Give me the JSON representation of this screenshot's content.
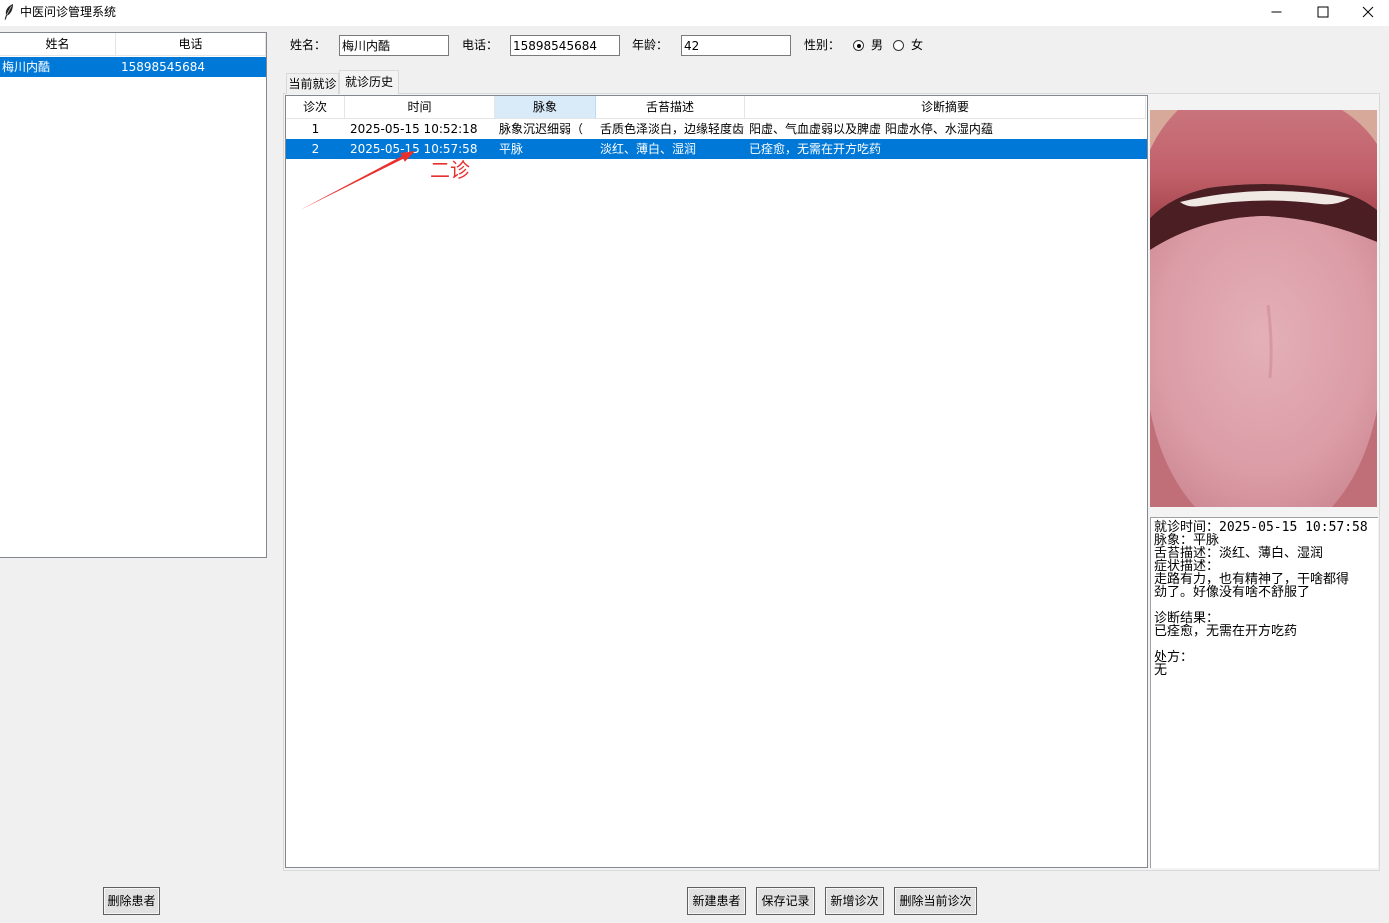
{
  "window": {
    "title": "中医问诊管理系统"
  },
  "icons": {
    "app": "feather-icon",
    "minimize": "minimize-icon",
    "maximize": "maximize-icon",
    "close": "close-icon",
    "annotation": "arrow-icon"
  },
  "colors": {
    "accent": "#0078d7",
    "header_hover": "#d9ebf9",
    "annotation": "#e8312f"
  },
  "patient_list": {
    "columns": [
      "姓名",
      "电话"
    ],
    "rows": [
      {
        "name": "梅川内酷",
        "phone": "15898545684",
        "selected": true
      }
    ]
  },
  "form": {
    "name": {
      "label": "姓名：",
      "value": "梅川内酷"
    },
    "phone": {
      "label": "电话：",
      "value": "15898545684"
    },
    "age": {
      "label": "年龄：",
      "value": "42"
    },
    "gender": {
      "label": "性别：",
      "options": [
        {
          "label": "男",
          "checked": true
        },
        {
          "label": "女",
          "checked": false
        }
      ]
    }
  },
  "tabs": [
    {
      "label": "当前就诊",
      "active": false
    },
    {
      "label": "就诊历史",
      "active": true
    }
  ],
  "history": {
    "columns": [
      {
        "label": "诊次",
        "hovered": false
      },
      {
        "label": "时间",
        "hovered": false
      },
      {
        "label": "脉象",
        "hovered": true
      },
      {
        "label": "舌苔描述",
        "hovered": false
      },
      {
        "label": "诊断摘要",
        "hovered": false
      }
    ],
    "rows": [
      {
        "visit": "1",
        "time": "2025-05-15 10:52:18",
        "pulse": "脉象沉迟细弱（",
        "tongue": "舌质色泽淡白，边缘轻度齿",
        "diagnosis": "阳虚、气血虚弱以及脾虚 阳虚水停、水湿内蕴",
        "selected": false
      },
      {
        "visit": "2",
        "time": "2025-05-15 10:57:58",
        "pulse": "平脉",
        "tongue": "淡红、薄白、湿润",
        "diagnosis": "已痊愈，无需在开方吃药",
        "selected": true
      }
    ]
  },
  "annotation": {
    "text": "二诊"
  },
  "detail": {
    "lines": [
      "就诊时间：2025-05-15 10:57:58",
      "脉象：平脉",
      "舌苔描述：淡红、薄白、湿润",
      "症状描述：",
      "走路有力，也有精神了，干啥都得",
      "劲了。好像没有啥不舒服了",
      "",
      "诊断结果：",
      "已痊愈，无需在开方吃药",
      "",
      "处方：",
      "无"
    ]
  },
  "buttons": {
    "delete_patient": "删除患者",
    "new_patient": "新建患者",
    "save_record": "保存记录",
    "new_visit": "新增诊次",
    "delete_visit": "删除当前诊次"
  }
}
